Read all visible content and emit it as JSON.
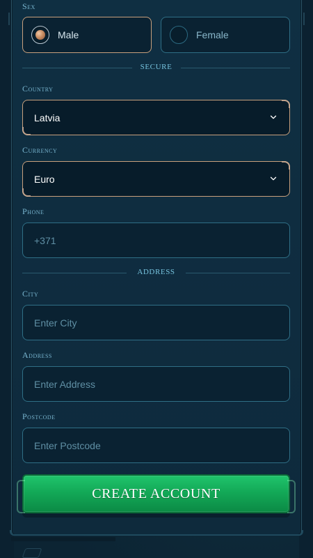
{
  "form": {
    "sex": {
      "label": "Sex",
      "options": [
        {
          "label": "Male",
          "selected": true
        },
        {
          "label": "Female",
          "selected": false
        }
      ]
    },
    "sections": {
      "secure": "SECURE",
      "address": "ADDRESS"
    },
    "country": {
      "label": "Country",
      "value": "Latvia"
    },
    "currency": {
      "label": "Currency",
      "value": "Euro"
    },
    "phone": {
      "label": "Phone",
      "placeholder": "+371"
    },
    "city": {
      "label": "City",
      "placeholder": "Enter City"
    },
    "address_line": {
      "label": "Address",
      "placeholder": "Enter Address"
    },
    "postcode": {
      "label": "Postcode",
      "placeholder": "Enter Postcode"
    },
    "actions": {
      "create_account": "CREATE ACCOUNT"
    }
  },
  "colors": {
    "panel": "#0f2f42",
    "accent_border": "#2f6f86",
    "selected_border": "#c8a07d",
    "button_green": "#13a957"
  },
  "icons": {
    "dropdown": "chevron-down-icon"
  }
}
